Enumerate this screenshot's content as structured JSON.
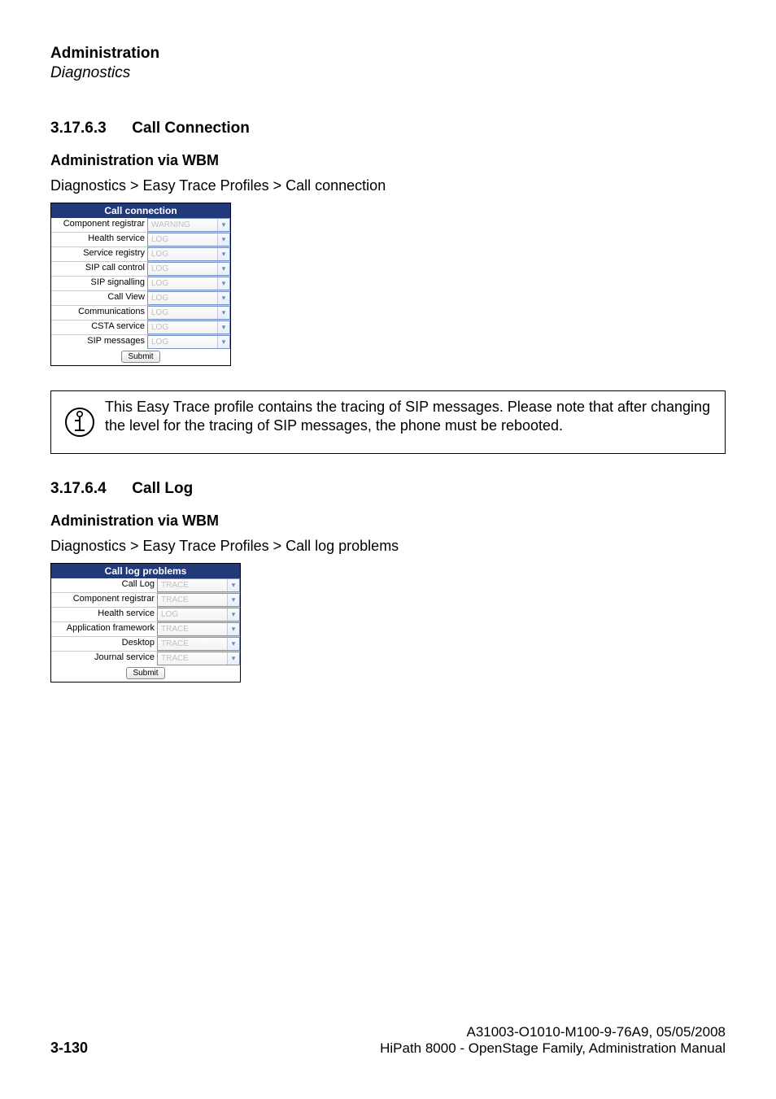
{
  "header": {
    "title": "Administration",
    "subtitle": "Diagnostics"
  },
  "section1": {
    "num": "3.17.6.3",
    "title": "Call Connection",
    "admin_via": "Administration via WBM",
    "breadcrumb": "Diagnostics > Easy Trace Profiles > Call connection",
    "panel_title": "Call connection",
    "rows": [
      {
        "label": "Component registrar",
        "value": "WARNING"
      },
      {
        "label": "Health service",
        "value": "LOG"
      },
      {
        "label": "Service registry",
        "value": "LOG"
      },
      {
        "label": "SIP call control",
        "value": "LOG"
      },
      {
        "label": "SIP signalling",
        "value": "LOG"
      },
      {
        "label": "Call View",
        "value": "LOG"
      },
      {
        "label": "Communications",
        "value": "LOG"
      },
      {
        "label": "CSTA service",
        "value": "LOG"
      },
      {
        "label": "SIP messages",
        "value": "LOG"
      }
    ],
    "submit": "Submit",
    "note": "This Easy Trace profile contains the tracing of SIP messages. Please note that after changing the level for the tracing of SIP messages, the phone must be rebooted."
  },
  "section2": {
    "num": "3.17.6.4",
    "title": "Call Log",
    "admin_via": "Administration via WBM",
    "breadcrumb": "Diagnostics > Easy Trace Profiles > Call log problems",
    "panel_title": "Call log problems",
    "rows": [
      {
        "label": "Call Log",
        "value": "TRACE"
      },
      {
        "label": "Component registrar",
        "value": "TRACE"
      },
      {
        "label": "Health service",
        "value": "LOG"
      },
      {
        "label": "Application framework",
        "value": "TRACE"
      },
      {
        "label": "Desktop",
        "value": "TRACE"
      },
      {
        "label": "Journal service",
        "value": "TRACE"
      }
    ],
    "submit": "Submit"
  },
  "footer": {
    "page": "3-130",
    "doc_id": "A31003-O1010-M100-9-76A9, 05/05/2008",
    "doc_title": "HiPath 8000 - OpenStage Family, Administration Manual"
  }
}
